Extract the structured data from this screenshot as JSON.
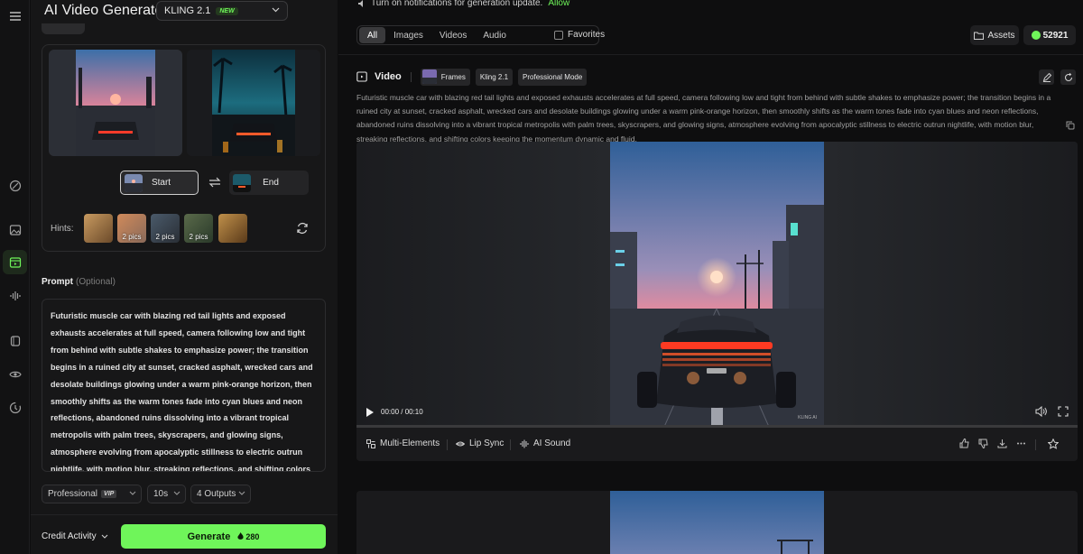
{
  "app": {
    "title": "AI Video Generator"
  },
  "model": {
    "name": "KLING 2.1",
    "badge": "NEW"
  },
  "frames": {
    "start_label": "Start",
    "end_label": "End"
  },
  "hints": {
    "label": "Hints:",
    "items": [
      {
        "pics": ""
      },
      {
        "pics": "2 pics"
      },
      {
        "pics": "2 pics"
      },
      {
        "pics": "2 pics"
      },
      {
        "pics": ""
      }
    ]
  },
  "prompt": {
    "label": "Prompt",
    "optional": "(Optional)",
    "text": "Futuristic muscle car with blazing red tail lights and exposed exhausts accelerates at full speed, camera following low and tight from behind with subtle shakes to emphasize power; the transition begins in a ruined city at sunset, cracked asphalt, wrecked cars and desolate buildings glowing under a warm pink-orange horizon, then smoothly shifts as the warm tones fade into cyan blues and neon reflections, abandoned ruins dissolving into a vibrant tropical metropolis with palm trees, skyscrapers, and glowing signs, atmosphere evolving from apocalyptic stillness to electric outrun nightlife, with motion blur, streaking reflections, and shifting colors keeping the momentum dynamic and fluid."
  },
  "options": {
    "mode": "Professional",
    "mode_badge": "VIP",
    "duration": "10s",
    "outputs": "4 Outputs"
  },
  "footer": {
    "credit_activity": "Credit Activity",
    "generate_label": "Generate",
    "generate_cost": "280"
  },
  "notification": {
    "text": "Turn on notifications for generation update.",
    "action": "Allow"
  },
  "filters": {
    "tabs": [
      "All",
      "Images",
      "Videos",
      "Audio"
    ],
    "active": "All",
    "favorites": "Favorites"
  },
  "account": {
    "assets_label": "Assets",
    "credits": "52921"
  },
  "result": {
    "title": "Video",
    "chips": [
      "Frames",
      "Kling 2.1",
      "Professional Mode"
    ],
    "description": "Futuristic muscle car with blazing red tail lights and exposed exhausts accelerates at full speed, camera following low and tight from behind with subtle shakes to emphasize power; the transition begins in a ruined city at sunset, cracked asphalt, wrecked cars and desolate buildings glowing under a warm pink-orange horizon, then smoothly shifts as the warm tones fade into cyan blues and neon reflections, abandoned ruins dissolving into a vibrant tropical metropolis with palm trees, skyscrapers, and glowing signs, atmosphere evolving from apocalyptic stillness to electric outrun nightlife, with motion blur, streaking reflections, and shifting colors keeping the momentum dynamic and fluid.",
    "time": "00:00 / 00:10",
    "actions": {
      "multi_elements": "Multi-Elements",
      "lip_sync": "Lip Sync",
      "ai_sound": "AI Sound"
    },
    "watermark": "KLING AI"
  },
  "colors": {
    "accent": "#6ff55a",
    "panel": "#161617",
    "background": "#0e0e0f"
  }
}
